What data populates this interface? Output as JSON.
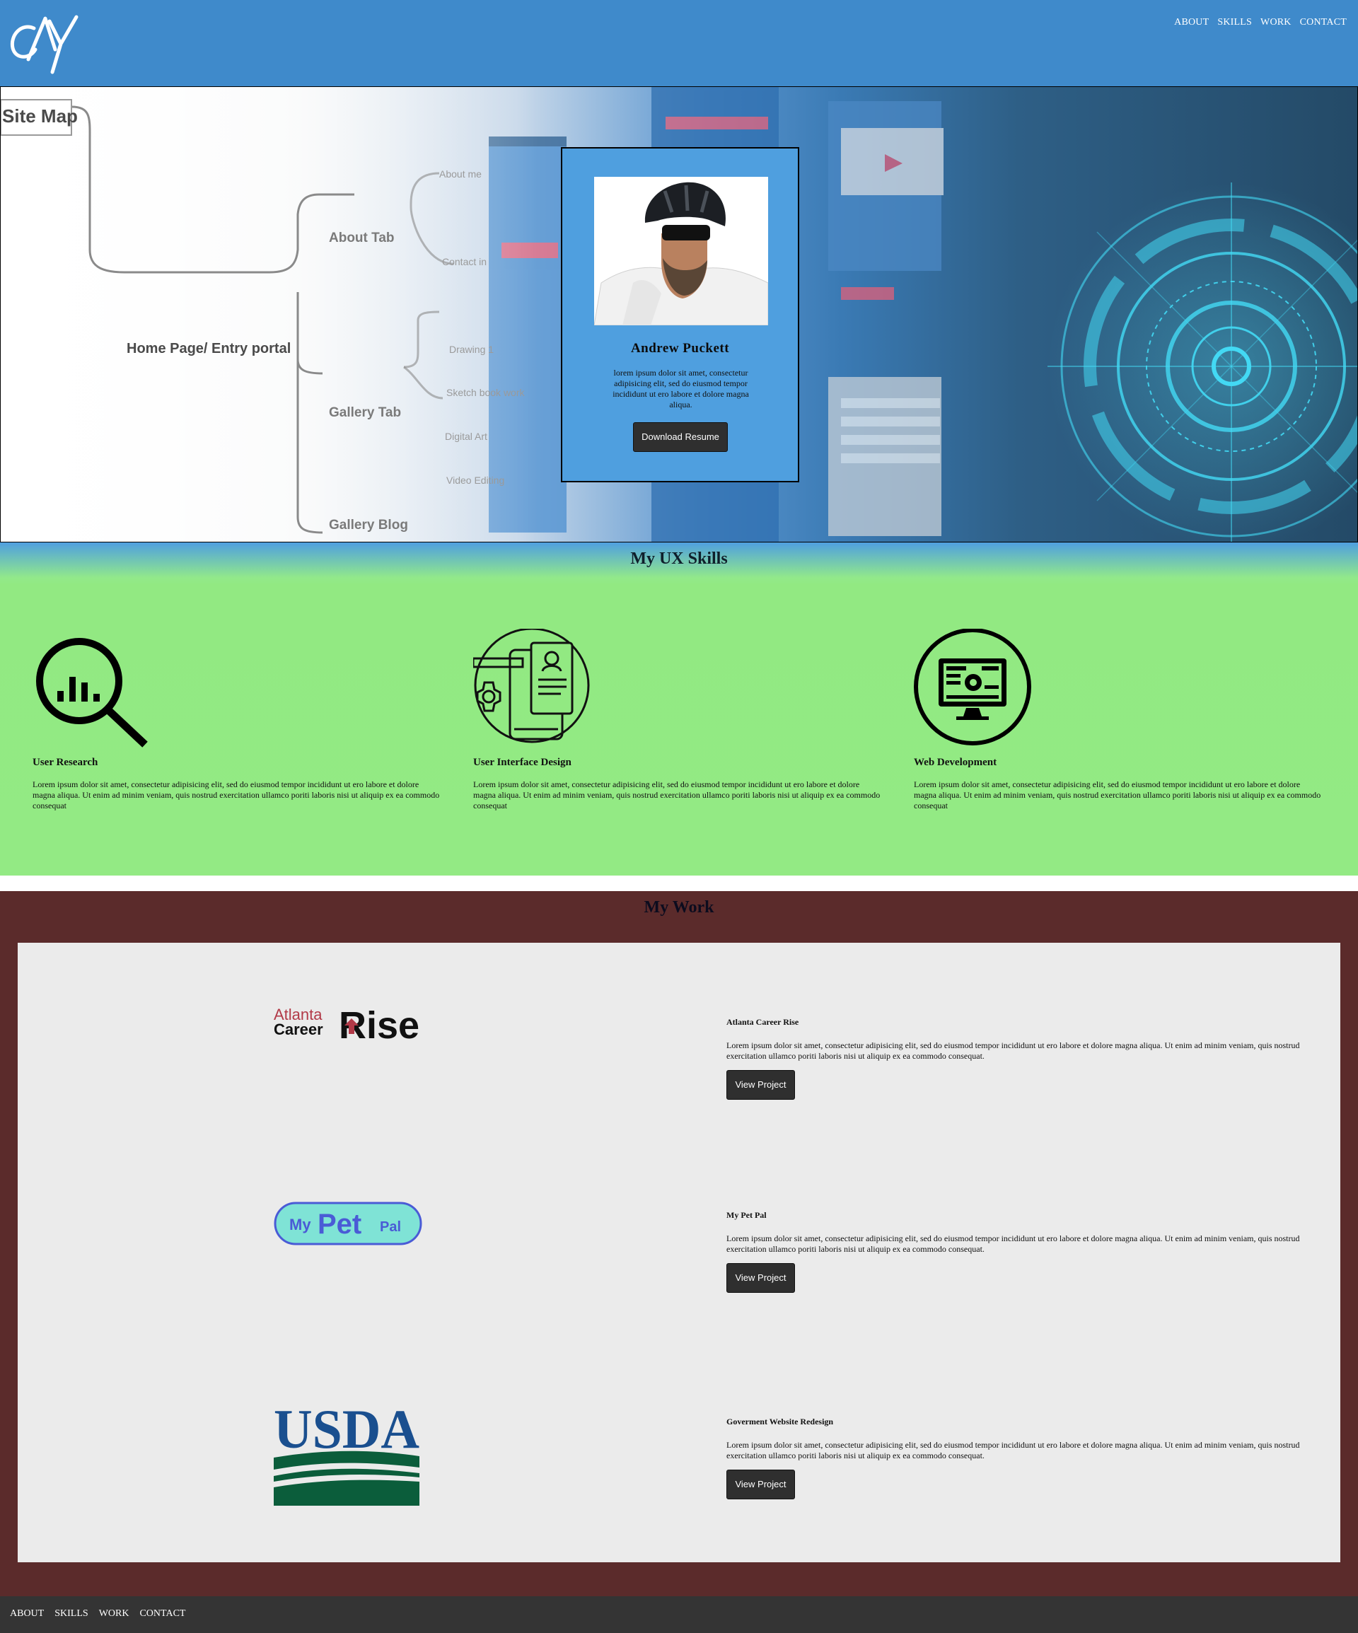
{
  "header": {
    "logo_text": "AY",
    "nav": [
      {
        "label": "ABOUT"
      },
      {
        "label": "SKILLS"
      },
      {
        "label": "WORK"
      },
      {
        "label": "CONTACT"
      }
    ]
  },
  "hero": {
    "sitemap": {
      "title": "Site Map",
      "nodes": [
        "Home Page/ Entry portal",
        "About Tab",
        "Gallery Tab",
        "Gallery Blog",
        "About me",
        "Contact in",
        "Drawing 1",
        "Sketch book work",
        "Digital Art",
        "Video Editing"
      ]
    },
    "profile": {
      "name": "Andrew Puckett",
      "bio": "lorem ipsum dolor sit amet, consectetur adipisicing elit, sed do eiusmod tempor incididunt ut ero labore et dolore magna aliqua.",
      "button": "Download Resume"
    }
  },
  "skills": {
    "title": "My UX Skills",
    "items": [
      {
        "title": "User Research",
        "icon": "research-magnifier-chart-icon",
        "text": "Lorem ipsum dolor sit amet, consectetur adipisicing elit, sed do eiusmod tempor incididunt ut ero labore et dolore magna aliqua. Ut enim ad minim veniam, quis nostrud exercitation ullamco poriti laboris nisi ut aliquip ex ea commodo consequat"
      },
      {
        "title": "User Interface Design",
        "icon": "ui-design-device-icon",
        "text": "Lorem ipsum dolor sit amet, consectetur adipisicing elit, sed do eiusmod tempor incididunt ut ero labore et dolore magna aliqua. Ut enim ad minim veniam, quis nostrud exercitation ullamco poriti laboris nisi ut aliquip ex ea commodo consequat"
      },
      {
        "title": "Web Development",
        "icon": "web-development-monitor-icon",
        "text": "Lorem ipsum dolor sit amet, consectetur adipisicing elit, sed do eiusmod tempor incididunt ut ero labore et dolore magna aliqua. Ut enim ad minim veniam, quis nostrud exercitation ullamco poriti laboris nisi ut aliquip ex ea commodo consequat"
      }
    ]
  },
  "work": {
    "title": "My Work",
    "projects": [
      {
        "title": "Atlanta Career Rise",
        "logo": {
          "line1": "Atlanta",
          "line2": "Career",
          "word": "Rise"
        },
        "text": "Lorem ipsum dolor sit amet, consectetur adipisicing elit, sed do eiusmod tempor incididunt ut ero labore et dolore magna aliqua. Ut enim ad minim veniam, quis nostrud exercitation ullamco poriti laboris nisi ut aliquip ex ea commodo consequat.",
        "button": "View Project"
      },
      {
        "title": "My Pet Pal",
        "logo": {
          "my": "My",
          "pet": "Pet",
          "pal": "Pal"
        },
        "text": "Lorem ipsum dolor sit amet, consectetur adipisicing elit, sed do eiusmod tempor incididunt ut ero labore et dolore magna aliqua. Ut enim ad minim veniam, quis nostrud exercitation ullamco poriti laboris nisi ut aliquip ex ea commodo consequat.",
        "button": "View Project"
      },
      {
        "title": "Goverment Website Redesign",
        "logo": {
          "word": "USDA"
        },
        "text": "Lorem ipsum dolor sit amet, consectetur adipisicing elit, sed do eiusmod tempor incididunt ut ero labore et dolore magna aliqua. Ut enim ad minim veniam, quis nostrud exercitation ullamco poriti laboris nisi ut aliquip ex ea commodo consequat.",
        "button": "View Project"
      }
    ]
  },
  "footer": {
    "nav": [
      {
        "label": "ABOUT"
      },
      {
        "label": "SKILLS"
      },
      {
        "label": "WORK"
      },
      {
        "label": "CONTACT"
      }
    ]
  },
  "colors": {
    "header_blue": "#3f8acb",
    "card_blue": "#4f9fdf",
    "skills_green": "#92e982",
    "work_maroon": "#5b2b2b",
    "panel_gray": "#ebebeb",
    "button_dark": "#2f2f2f",
    "footer_dark": "#343434"
  }
}
